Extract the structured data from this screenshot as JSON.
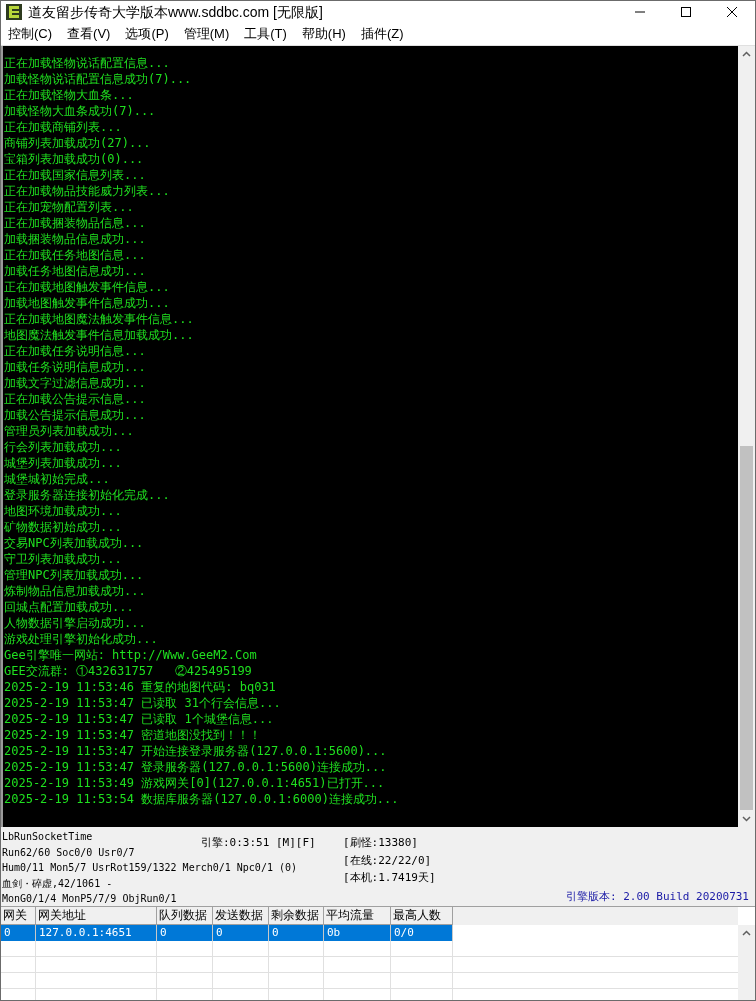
{
  "window": {
    "title": "道友留步传奇大学版本www.sddbc.com [无限版]"
  },
  "menu": [
    "控制(C)",
    "查看(V)",
    "选项(P)",
    "管理(M)",
    "工具(T)",
    "帮助(H)",
    "插件(Z)"
  ],
  "log": {
    "lines": [
      "正在加载怪物说话配置信息...",
      "加载怪物说话配置信息成功(7)...",
      "正在加载怪物大血条...",
      "加载怪物大血条成功(7)...",
      "正在加载商铺列表...",
      "商铺列表加载成功(27)...",
      "宝箱列表加载成功(0)...",
      "正在加载国家信息列表...",
      "正在加载物品技能威力列表...",
      "正在加宠物配置列表...",
      "正在加载捆装物品信息...",
      "加载捆装物品信息成功...",
      "正在加载任务地图信息...",
      "加载任务地图信息成功...",
      "正在加载地图触发事件信息...",
      "加载地图触发事件信息成功...",
      "正在加载地图魔法触发事件信息...",
      "地图魔法触发事件信息加载成功...",
      "正在加载任务说明信息...",
      "加载任务说明信息成功...",
      "加载文字过滤信息成功...",
      "正在加载公告提示信息...",
      "加载公告提示信息成功...",
      "管理员列表加载成功...",
      "行会列表加载成功...",
      "城堡列表加载成功...",
      "城堡城初始完成...",
      "登录服务器连接初始化完成...",
      "地图环境加载成功...",
      "矿物数据初始成功...",
      "交易NPC列表加载成功...",
      "守卫列表加载成功...",
      "管理NPC列表加载成功...",
      "炼制物品信息加载成功...",
      "回城点配置加载成功...",
      "人物数据引擎启动成功...",
      "游戏处理引擎初始化成功...",
      "Gee引擎唯一网站: http://Www.GeeM2.Com",
      "GEE交流群: ①432631757   ②425495199",
      "2025-2-19 11:53:46 重复的地图代码: bq031",
      "2025-2-19 11:53:47 已读取 31个行会信息...",
      "2025-2-19 11:53:47 已读取 1个城堡信息...",
      "2025-2-19 11:53:47 密道地图没找到！！！",
      "2025-2-19 11:53:47 开始连接登录服务器(127.0.0.1:5600)...",
      "2025-2-19 11:53:47 登录服务器(127.0.0.1:5600)连接成功...",
      "2025-2-19 11:53:49 游戏网关[0](127.0.0.1:4651)已打开...",
      "2025-2-19 11:53:54 数据库服务器(127.0.0.1:6000)连接成功..."
    ]
  },
  "status": {
    "left": [
      "LbRunSocketTime",
      "Run62/60 Soc0/0 Usr0/7",
      "Hum0/11 Mon5/7 UsrRot159/1322 Merch0/1 Npc0/1 (0)",
      "血剑・碎虚,42/1061 -",
      "MonG0/1/4 MonP5/7/9 ObjRun0/1"
    ],
    "engine": "引擎:0:3:51 [M][F]",
    "right": [
      "[刷怪:13380]",
      "[在线:22/22/0]",
      "[本机:1.7419天]"
    ],
    "version": "引擎版本: 2.00 Build 20200731"
  },
  "table": {
    "columns": [
      "网关",
      "网关地址",
      "队列数据",
      "发送数据",
      "剩余数据",
      "平均流量",
      "最高人数"
    ],
    "rows": [
      {
        "cells": [
          "0",
          "127.0.0.1:4651",
          "0",
          "0",
          "0",
          "0b",
          "0/0"
        ],
        "selected": true
      }
    ]
  }
}
